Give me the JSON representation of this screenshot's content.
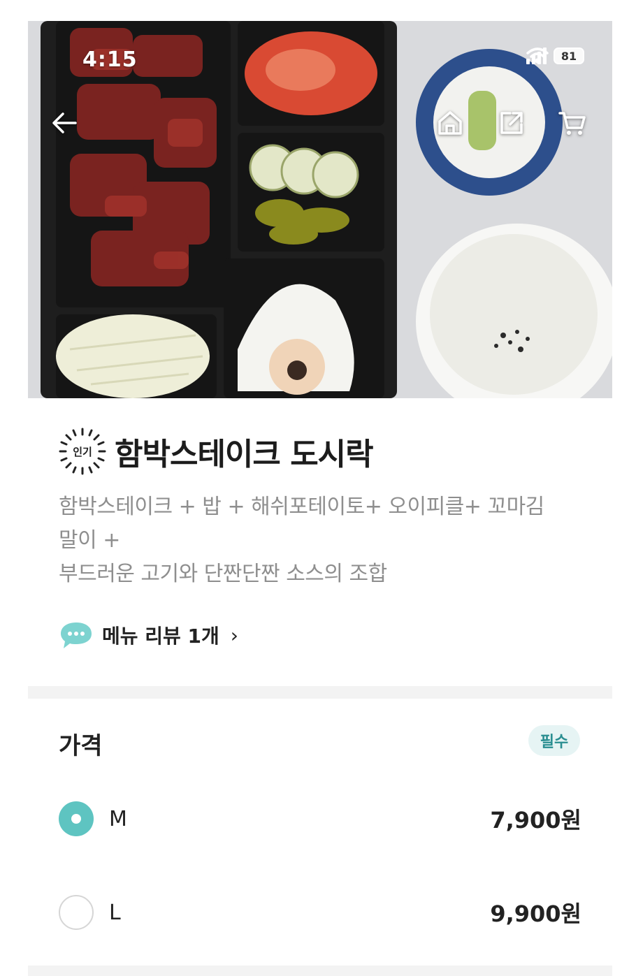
{
  "status_bar": {
    "time": "4:15",
    "battery": "81"
  },
  "nav": {
    "back": "back-arrow",
    "home": "home",
    "share": "share",
    "cart": "cart"
  },
  "menu": {
    "badge": "인기",
    "title": "함박스테이크 도시락",
    "description_lines": [
      "함박스테이크 + 밥 + 해쉬포테이토+ 오이피클+ 꼬마김",
      "말이 +",
      "부드러운 고기와 단짠단짠 소스의 조합"
    ],
    "review_label": "메뉴 리뷰 1개",
    "review_chevron": "›"
  },
  "price_section": {
    "title": "가격",
    "required_label": "필수",
    "options": [
      {
        "label": "M",
        "price": "7,900원",
        "selected": true
      },
      {
        "label": "L",
        "price": "9,900원",
        "selected": false
      }
    ]
  },
  "colors": {
    "accent": "#5ec4c1",
    "required_bg": "#e6f4f4",
    "required_text": "#2a8e91",
    "muted_text": "#8e8e8e"
  }
}
